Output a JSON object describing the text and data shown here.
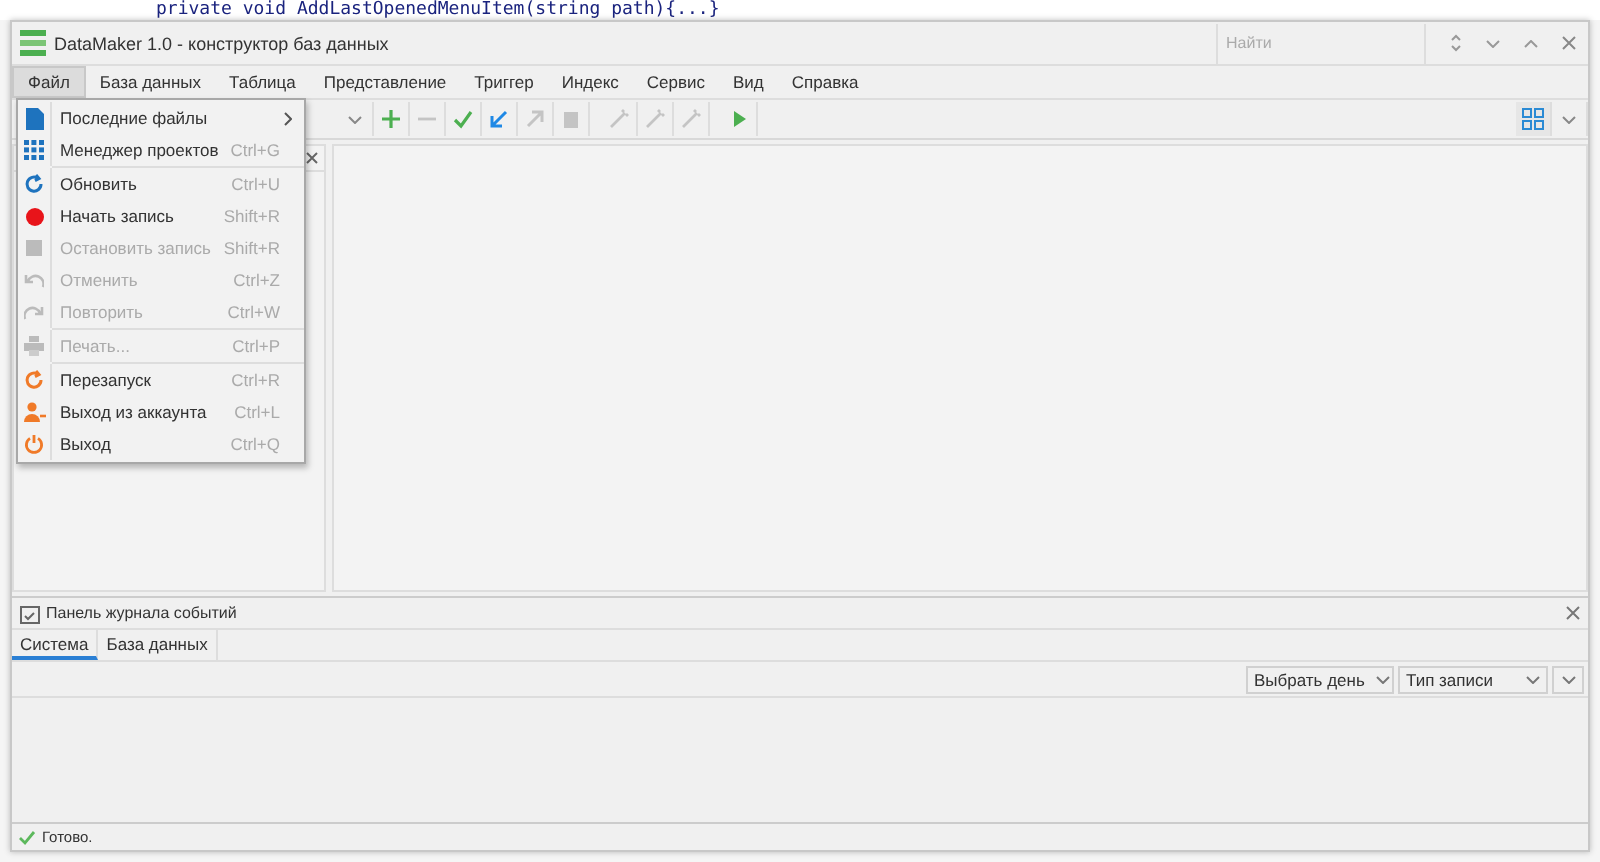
{
  "background_code": "private void AddLastOpenedMenuItem(string path){...}",
  "window": {
    "title": "DataMaker 1.0 - конструктор баз данных"
  },
  "search": {
    "placeholder": "Найти"
  },
  "menu_bar": [
    {
      "label": "Файл",
      "selected": true
    },
    {
      "label": "База данных",
      "selected": false
    },
    {
      "label": "Таблица",
      "selected": false
    },
    {
      "label": "Представление",
      "selected": false
    },
    {
      "label": "Триггер",
      "selected": false
    },
    {
      "label": "Индекс",
      "selected": false
    },
    {
      "label": "Сервис",
      "selected": false
    },
    {
      "label": "Вид",
      "selected": false
    },
    {
      "label": "Справка",
      "selected": false
    }
  ],
  "file_menu": [
    {
      "kind": "item",
      "label": "Последние файлы",
      "submenu": true,
      "disabled": false
    },
    {
      "kind": "item",
      "label": "Менеджер проектов",
      "shortcut": "Ctrl+G",
      "submenu": false,
      "disabled": false
    },
    {
      "kind": "separator"
    },
    {
      "kind": "item",
      "label": "Обновить",
      "shortcut": "Ctrl+U",
      "submenu": false,
      "disabled": false
    },
    {
      "kind": "item",
      "label": "Начать запись",
      "shortcut": "Shift+R",
      "submenu": false,
      "disabled": false
    },
    {
      "kind": "item",
      "label": "Остановить запись",
      "shortcut": "Shift+R",
      "submenu": false,
      "disabled": true
    },
    {
      "kind": "item",
      "label": "Отменить",
      "shortcut": "Ctrl+Z",
      "submenu": false,
      "disabled": true
    },
    {
      "kind": "item",
      "label": "Повторить",
      "shortcut": "Ctrl+W",
      "submenu": false,
      "disabled": true
    },
    {
      "kind": "separator"
    },
    {
      "kind": "item",
      "label": "Печать...",
      "shortcut": "Ctrl+P",
      "submenu": false,
      "disabled": true
    },
    {
      "kind": "separator"
    },
    {
      "kind": "item",
      "label": "Перезапуск",
      "shortcut": "Ctrl+R",
      "submenu": false,
      "disabled": false
    },
    {
      "kind": "item",
      "label": "Выход из аккаунта",
      "shortcut": "Ctrl+L",
      "submenu": false,
      "disabled": false
    },
    {
      "kind": "item",
      "label": "Выход",
      "shortcut": "Ctrl+Q",
      "submenu": false,
      "disabled": false
    }
  ],
  "toolbar": [
    {
      "disabled": false
    },
    {
      "disabled": true
    },
    {
      "disabled": false
    },
    {
      "disabled": false
    },
    {
      "disabled": true
    },
    {
      "disabled": true
    },
    {
      "disabled": true
    },
    {
      "disabled": true
    },
    {
      "disabled": true
    },
    {
      "disabled": false
    }
  ],
  "log_panel": {
    "title": "Панель журнала событий",
    "tabs": [
      {
        "label": "Система",
        "selected": true
      },
      {
        "label": "База данных",
        "selected": false
      }
    ],
    "filters": [
      "Выбрать день",
      "Тип записи"
    ]
  },
  "status_bar": {
    "text": "Готово."
  }
}
